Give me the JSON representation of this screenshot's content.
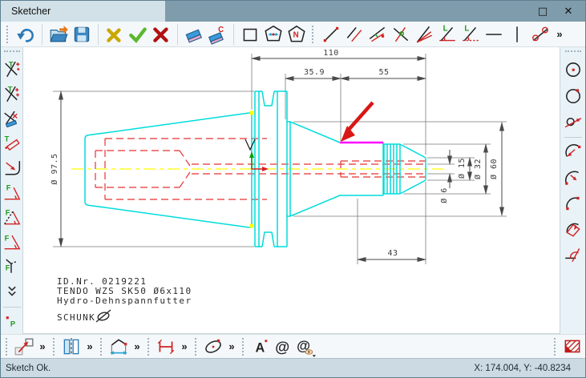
{
  "colors": {
    "titlebar": "#7e9cac",
    "titlebar_tab": "#d2e1e8",
    "toolbar_bg": "#f4f8fa",
    "sidebar_bg": "#e9f2f7",
    "statusbar_bg": "#ccdbe3",
    "canvas_bg": "#ffffff",
    "geometry_cyan": "#00dcdc",
    "hidden_red": "#e63232",
    "centerline_yellow": "#ffff00",
    "highlight_magenta": "#ff00ff",
    "dimension_gray": "#4a4a4a",
    "annotation_arrow_red": "#d91616"
  },
  "window": {
    "title": "Sketcher",
    "maximize_glyph": "□",
    "close_glyph": "✕"
  },
  "glyphs": {
    "overflow": "»",
    "n": "N",
    "c": "C",
    "l": "L",
    "t": "T",
    "f": "F",
    "p": "P",
    "a": "A",
    "at": "@"
  },
  "drawing": {
    "dimensions": {
      "overall_length": "110",
      "mid_length": "35.9",
      "front_length": "55",
      "clamp_depth": "43",
      "flange_dia": "Ø 97.5",
      "bore_dia": "Ø 6",
      "nose_dia": "Ø 15",
      "body_dia": "Ø 32",
      "collar_dia": "Ø 60"
    },
    "note": {
      "line1": "ID.Nr. 0219221",
      "line2": "TENDO WZS SK50 Ø6x110",
      "line3": "Hydro-Dehnspannfutter",
      "brand": "SCHUNK"
    }
  },
  "status_bar": {
    "message": "Sketch Ok.",
    "coordinates": "X: 174.004, Y: -40.8234"
  }
}
